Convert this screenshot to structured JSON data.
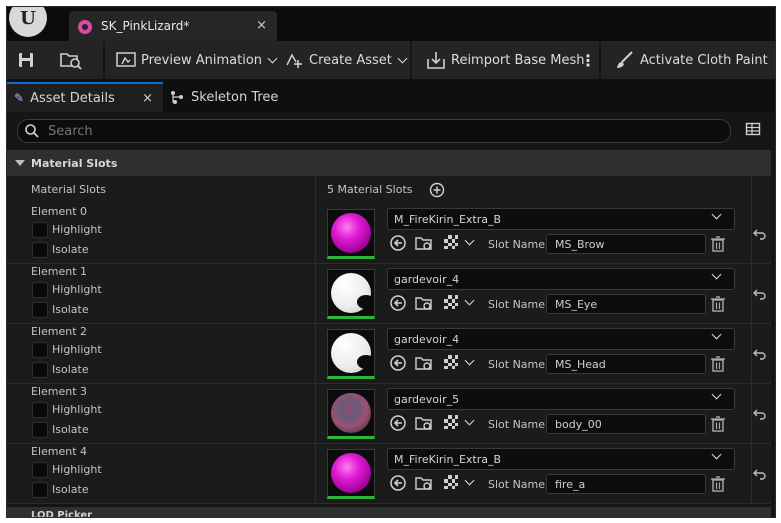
{
  "window": {
    "document_tab_title": "SK_PinkLizard*",
    "close_glyph": "×"
  },
  "toolbar": {
    "save_icon": "save-icon",
    "browse_icon": "browse-icon",
    "preview_animation": "Preview Animation",
    "create_asset": "Create Asset",
    "reimport_base_mesh": "Reimport Base Mesh",
    "activate_cloth_paint": "Activate Cloth Paint"
  },
  "panel_tabs": [
    {
      "label": "Asset Details",
      "active": true
    },
    {
      "label": "Skeleton Tree",
      "active": false
    }
  ],
  "search": {
    "placeholder": "Search"
  },
  "section": {
    "title": "Material Slots",
    "header_left": "Material Slots",
    "header_right": "5 Material Slots"
  },
  "elements": [
    {
      "label": "Element 0",
      "highlight": "Highlight",
      "isolate": "Isolate",
      "material": "M_FireKirin_Extra_B",
      "slot_label": "Slot Name",
      "slot_name": "MS_Brow",
      "thumb": "magenta"
    },
    {
      "label": "Element 1",
      "highlight": "Highlight",
      "isolate": "Isolate",
      "material": "gardevoir_4",
      "slot_label": "Slot Name",
      "slot_name": "MS_Eye",
      "thumb": "white"
    },
    {
      "label": "Element 2",
      "highlight": "Highlight",
      "isolate": "Isolate",
      "material": "gardevoir_4",
      "slot_label": "Slot Name",
      "slot_name": "MS_Head",
      "thumb": "white"
    },
    {
      "label": "Element 3",
      "highlight": "Highlight",
      "isolate": "Isolate",
      "material": "gardevoir_5",
      "slot_label": "Slot Name",
      "slot_name": "body_00",
      "thumb": "textured"
    },
    {
      "label": "Element 4",
      "highlight": "Highlight",
      "isolate": "Isolate",
      "material": "M_FireKirin_Extra_B",
      "slot_label": "Slot Name",
      "slot_name": "fire_a",
      "thumb": "magenta"
    }
  ],
  "next_section": {
    "title": "LOD Picker"
  },
  "colors": {
    "accent": "#0a6fd6",
    "pink": "#d94aa5",
    "thumb_border": "#2fb63a"
  }
}
